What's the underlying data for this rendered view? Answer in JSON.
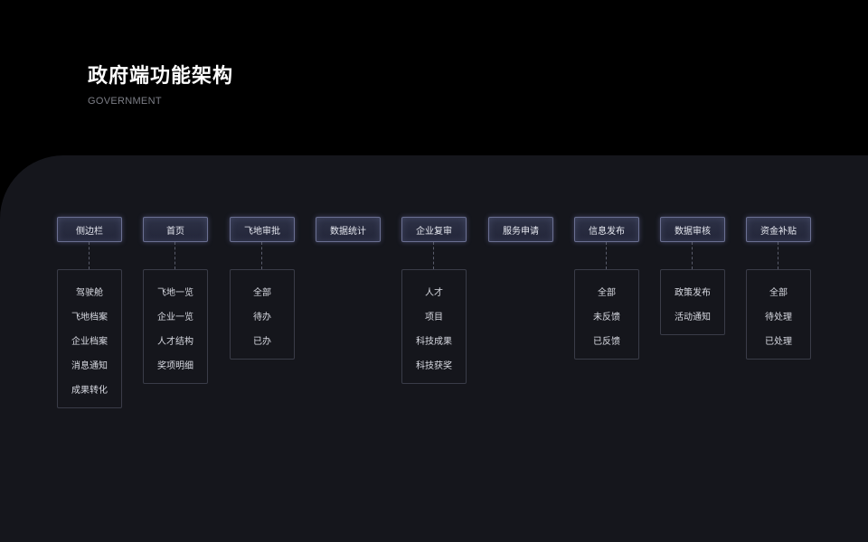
{
  "title": "政府端功能架构",
  "subtitle": "GOVERNMENT",
  "modules": [
    {
      "label": "侧边栏",
      "items": [
        "驾驶舱",
        "飞地档案",
        "企业档案",
        "消息通知",
        "成果转化"
      ]
    },
    {
      "label": "首页",
      "items": [
        "飞地一览",
        "企业一览",
        "人才结构",
        "奖项明细"
      ]
    },
    {
      "label": "飞地审批",
      "items": [
        "全部",
        "待办",
        "已办"
      ]
    },
    {
      "label": "数据统计",
      "items": []
    },
    {
      "label": "企业复审",
      "items": [
        "人才",
        "项目",
        "科技成果",
        "科技获奖"
      ]
    },
    {
      "label": "服务申请",
      "items": []
    },
    {
      "label": "信息发布",
      "items": [
        "全部",
        "未反馈",
        "已反馈"
      ]
    },
    {
      "label": "数据审核",
      "items": [
        "政策发布",
        "活动通知"
      ]
    },
    {
      "label": "资金补贴",
      "items": [
        "全部",
        "待处理",
        "已处理"
      ]
    }
  ]
}
